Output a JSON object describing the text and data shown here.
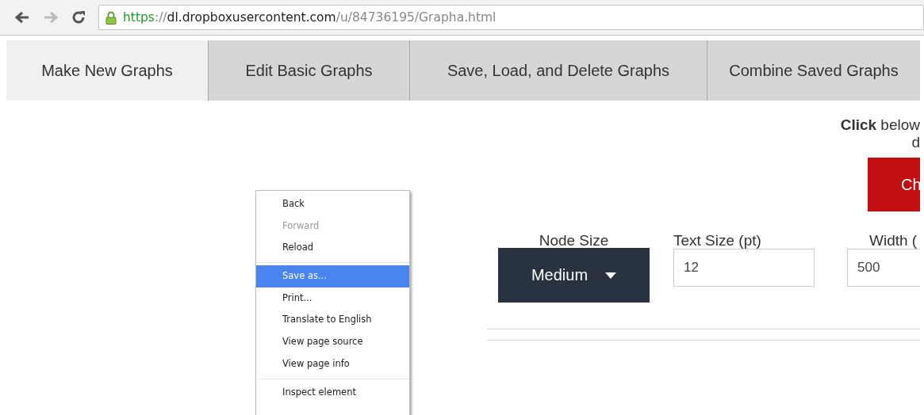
{
  "browser": {
    "url": {
      "scheme": "https",
      "separator": "://",
      "host": "dl.dropboxusercontent.com",
      "path": "/u/84736195/Grapha.html"
    },
    "back_disabled": false,
    "forward_disabled": true
  },
  "tabs": [
    {
      "label": "Make New Graphs",
      "selected": true
    },
    {
      "label": "Edit Basic Graphs",
      "selected": false
    },
    {
      "label": "Save, Load, and Delete Graphs",
      "selected": false
    },
    {
      "label": "Combine Saved Graphs",
      "selected": false
    }
  ],
  "instructions": {
    "line_1": "**Click** below",
    "line_2": "d"
  },
  "action_button": {
    "label": "Ch"
  },
  "controls": [
    {
      "kind": "dropdown",
      "label": "Node Size",
      "value": "Medium"
    },
    {
      "kind": "input",
      "label": "Text Size (pt)",
      "value": "12"
    },
    {
      "kind": "input",
      "label": "Width (",
      "value": "500"
    }
  ],
  "context_menu": {
    "groups": [
      [
        {
          "label": "Back",
          "disabled": false,
          "selected": false
        },
        {
          "label": "Forward",
          "disabled": true,
          "selected": false
        },
        {
          "label": "Reload",
          "disabled": false,
          "selected": false
        }
      ],
      [
        {
          "label": "Save as...",
          "disabled": false,
          "selected": true
        },
        {
          "label": "Print...",
          "disabled": false,
          "selected": false
        },
        {
          "label": "Translate to English",
          "disabled": false,
          "selected": false
        },
        {
          "label": "View page source",
          "disabled": false,
          "selected": false
        },
        {
          "label": "View page info",
          "disabled": false,
          "selected": false
        }
      ],
      [
        {
          "label": "Inspect element",
          "disabled": false,
          "selected": false
        }
      ]
    ]
  }
}
